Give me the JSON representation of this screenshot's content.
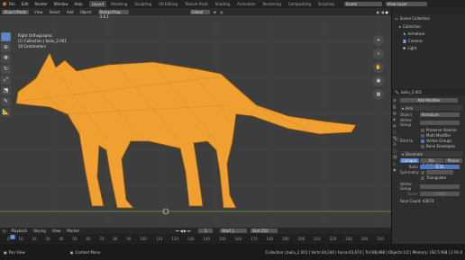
{
  "menu": [
    "File",
    "Edit",
    "Render",
    "Window",
    "Help"
  ],
  "workspaces": [
    "Layout",
    "Modeling",
    "Sculpting",
    "UV Editing",
    "Texture Paint",
    "Shading",
    "Animation",
    "Rendering",
    "Compositing",
    "Scripting"
  ],
  "active_workspace": "Layout",
  "scene_name": "Scene",
  "view_layer": "View Layer",
  "header": {
    "mode": "Object Mode",
    "menus": [
      "View",
      "Select",
      "Add",
      "Object"
    ],
    "addon": "RetopoFlow 3.0.1",
    "transform": "Global"
  },
  "viewport_info": [
    "Right Orthographic",
    "(1) Collection | bailu_2.001",
    "10 Centimeters"
  ],
  "outliner": {
    "title": "Scene Collection",
    "items": [
      "Collection",
      "Armature",
      "Camera",
      "Light"
    ]
  },
  "properties": {
    "object_name": "bailu_2.001",
    "add_modifier": "Add Modifier",
    "armature_mod": {
      "name": "Arm",
      "object_label": "Object",
      "object_value": "Armature",
      "vertex_group_label": "Vertex Group",
      "preserve_volume": "Preserve Volume",
      "multi_modifier": "Multi Modifier",
      "bind_to_label": "Bind to",
      "vertex_groups": "Vertex Groups",
      "bone_envelopes": "Bone Envelopes"
    },
    "decimate_mod": {
      "name": "Decimate",
      "tabs": [
        "Collapse",
        "Un-Subdivide",
        "Planar"
      ],
      "ratio_label": "Ratio",
      "ratio_value": "0.25",
      "symmetry_label": "Symmetry",
      "triangulate": "Triangulate",
      "vertex_group_label": "Vertex Group",
      "factor_label": "Factor",
      "factor_value": "1.000",
      "face_count": "Face Count: 43674"
    }
  },
  "timeline": {
    "menus": [
      "Playback",
      "Keying",
      "View",
      "Marker"
    ],
    "current_frame": "1",
    "start_label": "Start",
    "start": "1",
    "end_label": "End",
    "end": "250",
    "ticks": [
      "0",
      "10",
      "20",
      "30",
      "40",
      "50",
      "60",
      "70",
      "80",
      "90",
      "100",
      "110",
      "120",
      "130",
      "140",
      "150",
      "160",
      "170",
      "180",
      "190",
      "200",
      "210",
      "220",
      "230",
      "240",
      "250"
    ]
  },
  "status": {
    "left": "Pan View",
    "middle": "Context Menu",
    "right": "Collection | bailu_2.001 | Verts:44,344 | Faces:43,674 | Tris:88,988 | Objects:1/2 | Memory: 192.5 MiB | 2.91.0"
  },
  "colors": {
    "mesh": "#f0a030",
    "wire": "#7a4a10",
    "accent": "#4f79be",
    "viewport_bg": "#3d3d3d"
  }
}
